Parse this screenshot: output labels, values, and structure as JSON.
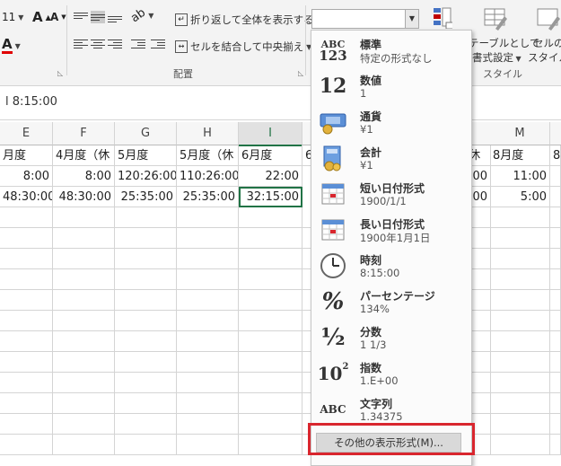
{
  "ribbon": {
    "font_size": "11",
    "grow_font": "A",
    "shrink_font": "A",
    "font_color_glyph": "A",
    "wrap_text": "折り返して全体を表示する",
    "merge_center": "セルを結合して中央揃え",
    "alignment_group": "配置",
    "table_format": "テーブルとして",
    "table_format_2": "書式設定",
    "cell_style": "セルの",
    "cell_style_2": "スタイル",
    "style_group": "スタイル",
    "number_format_value": ""
  },
  "formula_bar": {
    "text": "l  8:15:00"
  },
  "columns": [
    {
      "label": "E",
      "selected": false
    },
    {
      "label": "F",
      "selected": false
    },
    {
      "label": "G",
      "selected": false
    },
    {
      "label": "H",
      "selected": false
    },
    {
      "label": "I",
      "selected": true
    },
    {
      "label": "M",
      "selected": false
    }
  ],
  "rows": {
    "r1": [
      "月度",
      "4月度（休",
      "5月度",
      "5月度（休",
      "6月度",
      "6/",
      "(休",
      "8月度",
      "8"
    ],
    "r2": [
      "8:00",
      "8:00",
      "120:26:00",
      "110:26:00",
      "22:00",
      "00",
      "11:00"
    ],
    "r3": [
      "48:30:00",
      "48:30:00",
      "25:35:00",
      "25:35:00",
      "32:15:00",
      "00",
      "5:00"
    ]
  },
  "format_menu": {
    "items": [
      {
        "title": "標準",
        "sub": "特定の形式なし",
        "icon": "general-icon"
      },
      {
        "title": "数値",
        "sub": "1",
        "icon": "number-icon"
      },
      {
        "title": "通貨",
        "sub": "¥1",
        "icon": "currency-icon"
      },
      {
        "title": "会計",
        "sub": " ¥1",
        "icon": "accounting-icon"
      },
      {
        "title": "短い日付形式",
        "sub": "1900/1/1",
        "icon": "short-date-icon"
      },
      {
        "title": "長い日付形式",
        "sub": "1900年1月1日",
        "icon": "long-date-icon"
      },
      {
        "title": "時刻",
        "sub": "8:15:00",
        "icon": "clock-icon"
      },
      {
        "title": "パーセンテージ",
        "sub": "134%",
        "icon": "percent-icon"
      },
      {
        "title": "分数",
        "sub": "1 1/3",
        "icon": "fraction-icon"
      },
      {
        "title": "指数",
        "sub": "1.E+00",
        "icon": "scientific-icon"
      },
      {
        "title": "文字列",
        "sub": "1.34375",
        "icon": "text-icon"
      }
    ],
    "icon_labels": {
      "general_top": "ABC",
      "general_bottom": "123",
      "number": "12",
      "percent": "%",
      "fraction": "½",
      "sci": "10",
      "sci_exp": "2",
      "text": "ABC"
    },
    "more_formats": "その他の表示形式(M)..."
  },
  "colors": {
    "accent": "#217346",
    "highlight": "#d9262e"
  }
}
